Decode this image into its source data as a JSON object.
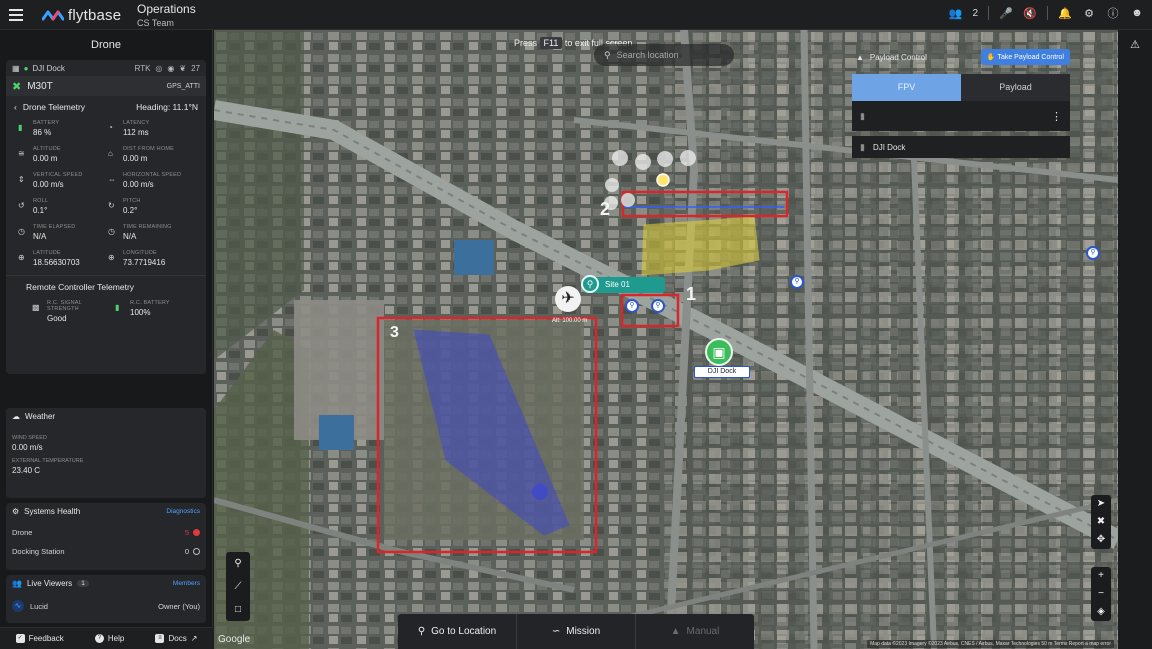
{
  "header": {
    "brand": "flytbase",
    "app_title": "Operations",
    "team": "CS Team",
    "viewer_count": "2"
  },
  "left_panel": {
    "title": "Drone",
    "dock_name": "DJI Dock",
    "dock_status": [
      "RTK",
      "27"
    ],
    "drone_name": "M30T",
    "gps_mode": "GPS_ATTI",
    "telemetry_title": "Drone Telemetry",
    "heading": "Heading: 11.1°N",
    "telemetry": [
      {
        "icon": "battery-icon",
        "label": "Battery",
        "value": "86 %"
      },
      {
        "icon": "latency-icon",
        "label": "Latency",
        "value": "112 ms"
      },
      {
        "icon": "altitude-icon",
        "label": "Altitude",
        "value": "0.00 m"
      },
      {
        "icon": "home-icon",
        "label": "Dist from home",
        "value": "0.00 m"
      },
      {
        "icon": "vertical-speed-icon",
        "label": "Vertical speed",
        "value": "0.00 m/s"
      },
      {
        "icon": "horizontal-speed-icon",
        "label": "Horizontal speed",
        "value": "0.00 m/s"
      },
      {
        "icon": "roll-icon",
        "label": "Roll",
        "value": "0.1°"
      },
      {
        "icon": "pitch-icon",
        "label": "Pitch",
        "value": "0.2°"
      },
      {
        "icon": "time-elapsed-icon",
        "label": "Time elapsed",
        "value": "N/A"
      },
      {
        "icon": "time-remaining-icon",
        "label": "Time remaining",
        "value": "N/A"
      },
      {
        "icon": "latitude-icon",
        "label": "Latitude",
        "value": "18.56630703"
      },
      {
        "icon": "longitude-icon",
        "label": "Longitude",
        "value": "73.7719416"
      }
    ],
    "rc_title": "Remote Controller Telemetry",
    "rc": [
      {
        "icon": "signal-icon",
        "label": "R.C. Signal Strength",
        "value": "Good"
      },
      {
        "icon": "rc-battery-icon",
        "label": "R.C. Battery",
        "value": "100%"
      }
    ],
    "weather_title": "Weather",
    "wind_label": "Wind speed",
    "wind_value": "0.00 m/s",
    "temp_label": "External temperature",
    "temp_value": "23.40 C",
    "health_title": "Systems Health",
    "diagnostics": "Diagnostics",
    "health": [
      {
        "label": "Drone",
        "value": "5"
      },
      {
        "label": "Docking Station",
        "value": "0"
      }
    ],
    "viewers_title": "Live Viewers",
    "viewers_count": "1",
    "members": "Members",
    "viewer_name": "Lucid",
    "viewer_role": "Owner (You)",
    "footer": [
      "Feedback",
      "Help",
      "Docs"
    ]
  },
  "map": {
    "fullscreen_prefix": "Press",
    "fullscreen_key": "F11",
    "fullscreen_suffix": "to exit full screen",
    "search_placeholder": "Search location",
    "site_label": "Site 01",
    "alt_label": "Alt: 100.00 m",
    "dock_label": "DJI Dock",
    "annotations": [
      "1",
      "2",
      "3"
    ],
    "payload_title": "Payload Control",
    "take_payload": "Take Payload Control",
    "tabs": [
      "FPV",
      "Payload"
    ],
    "dock_feed": "DJI Dock",
    "actions": [
      "Go to Location",
      "Mission",
      "Manual"
    ],
    "google": "Google",
    "attribution": "Map data ©2023 Imagery ©2023 Airbus, CNES / Airbus, Maxar Technologies   50 m   Terms   Report a map error"
  }
}
